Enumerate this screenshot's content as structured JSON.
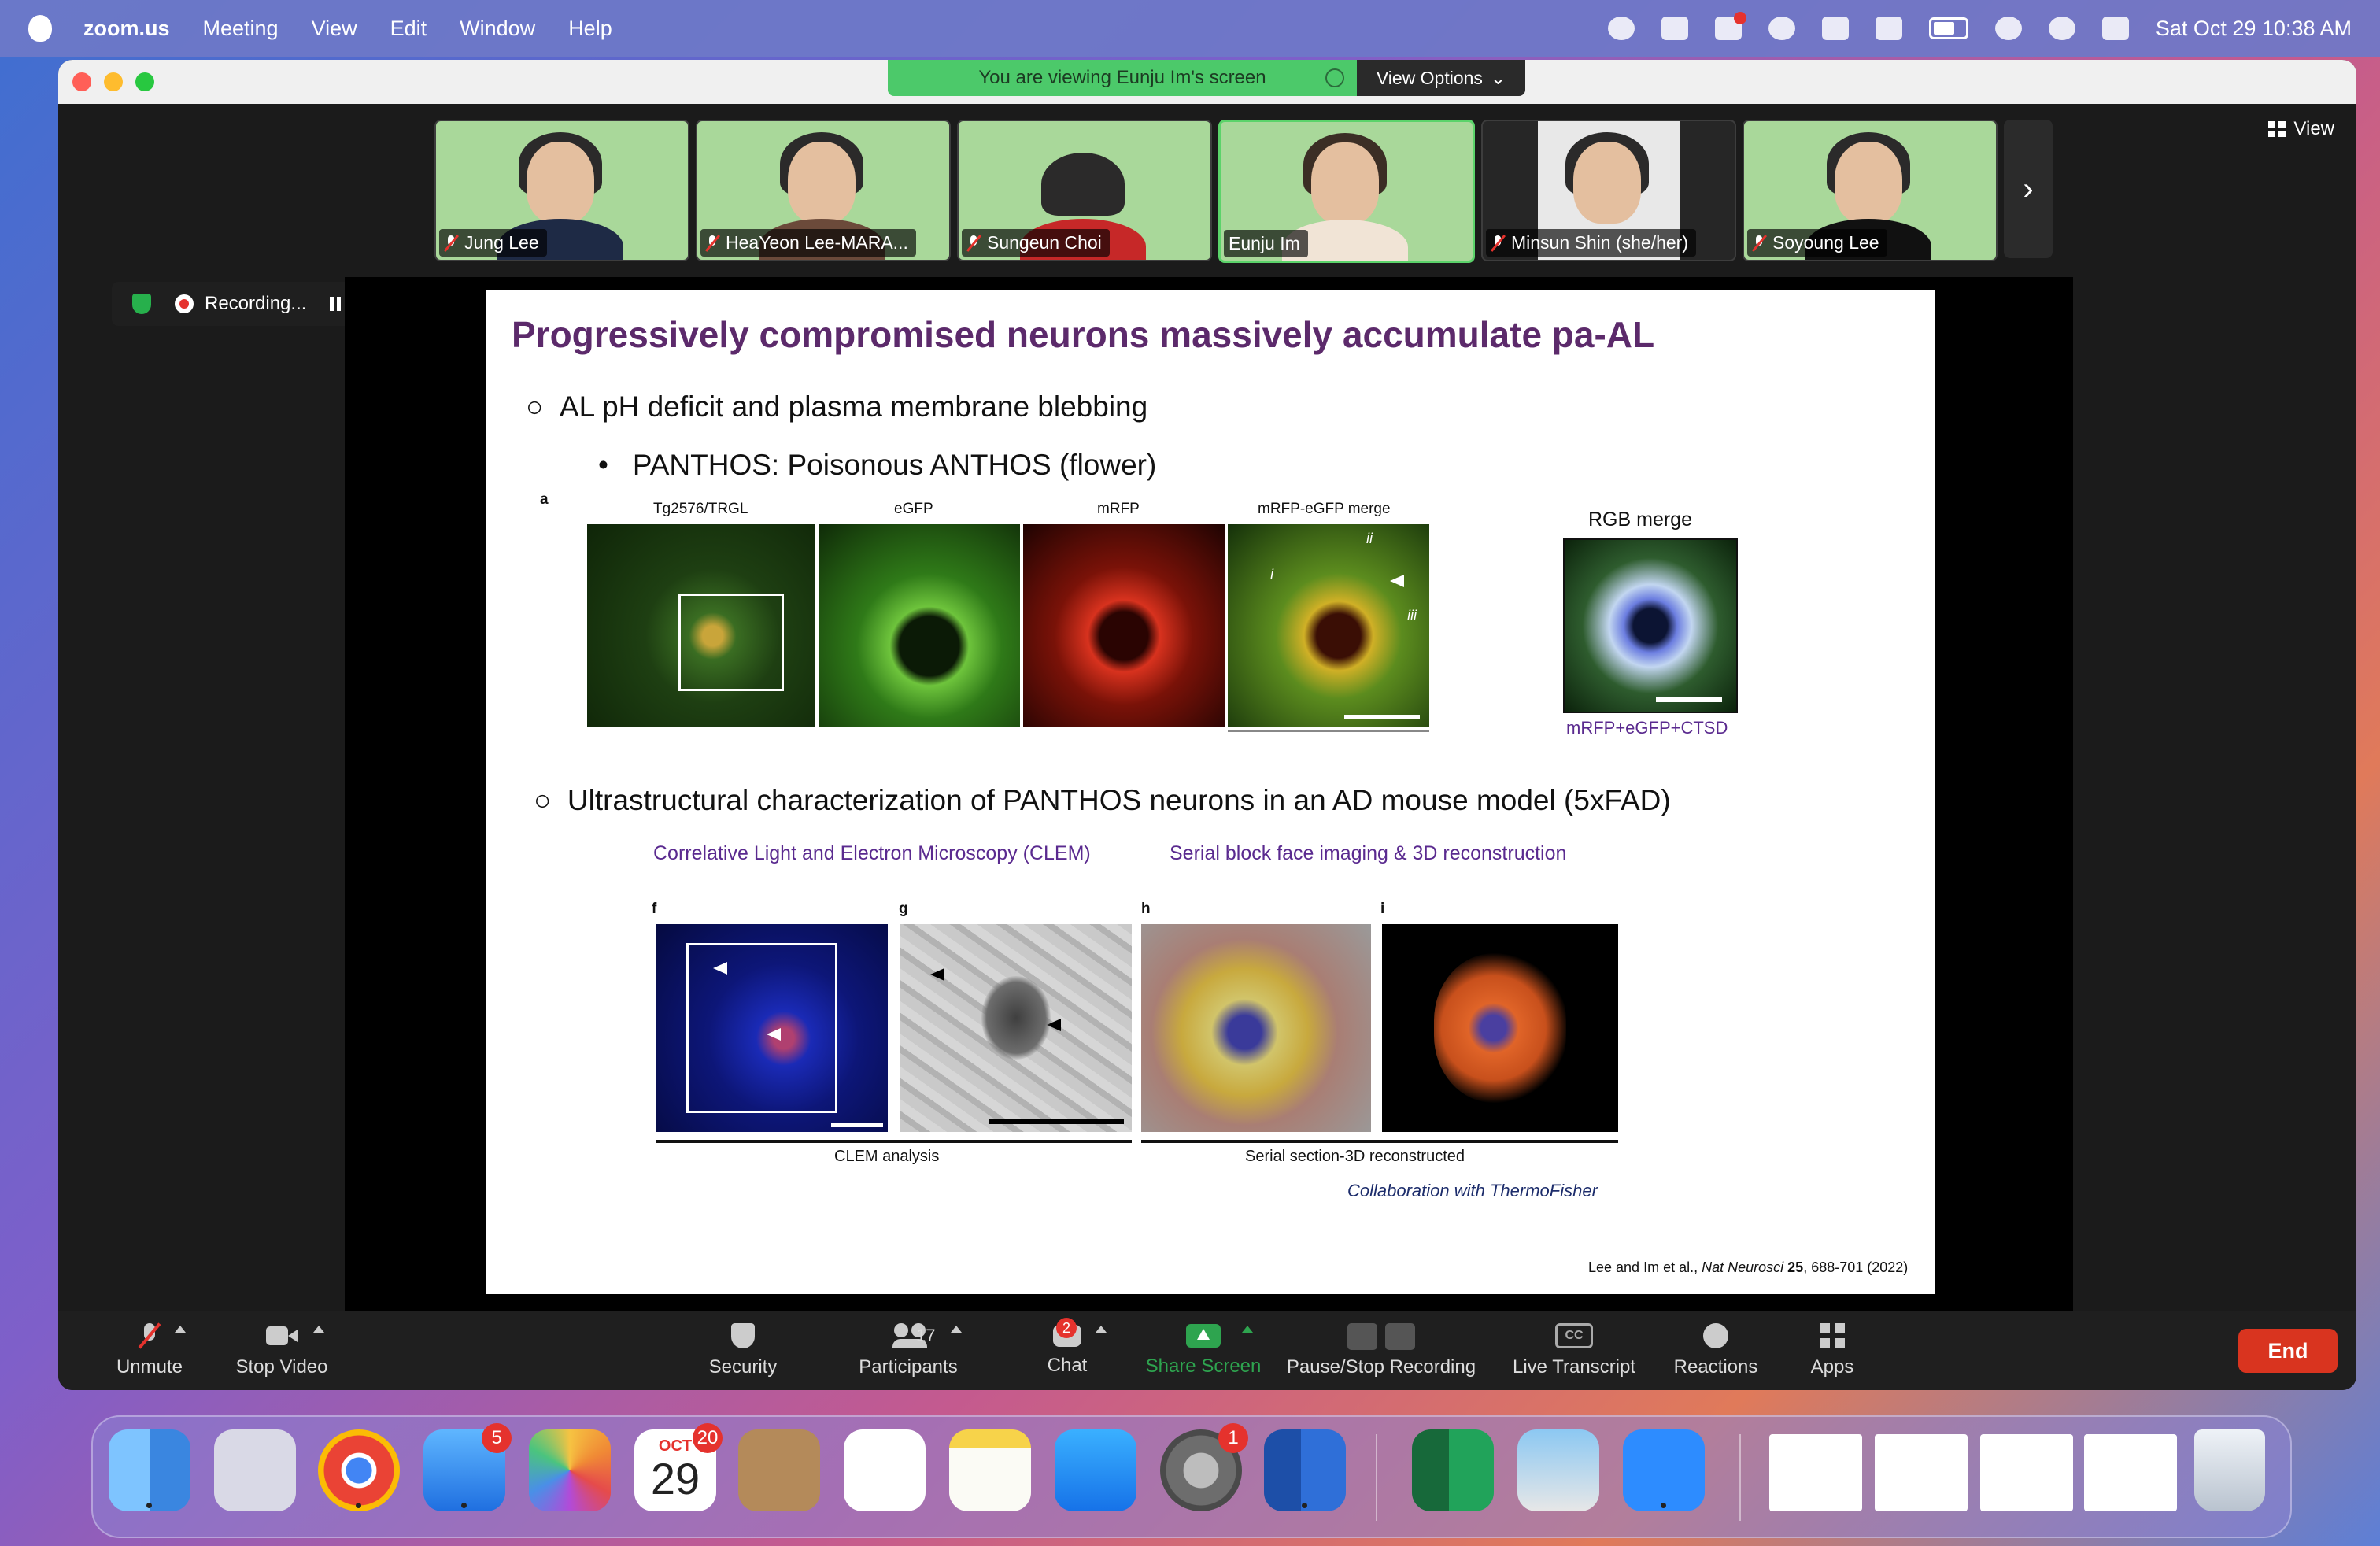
{
  "menubar": {
    "app_name": "zoom.us",
    "items": [
      "Meeting",
      "View",
      "Edit",
      "Window",
      "Help"
    ],
    "datetime": "Sat Oct 29  10:38 AM"
  },
  "window": {
    "share_banner": "You are viewing Eunju Im's screen",
    "view_options": "View Options",
    "view_label": "View"
  },
  "participants": [
    {
      "name": "Jung Lee",
      "muted": true
    },
    {
      "name": "HeaYeon Lee-MARA...",
      "muted": true
    },
    {
      "name": "Sungeun Choi",
      "muted": true
    },
    {
      "name": "Eunju Im",
      "muted": false,
      "active": true
    },
    {
      "name": "Minsun Shin (she/her)",
      "muted": true
    },
    {
      "name": "Soyoung Lee",
      "muted": true
    }
  ],
  "recording": {
    "label": "Recording..."
  },
  "slide": {
    "title": "Progressively compromised neurons massively accumulate pa-AL",
    "bullet1": "AL pH deficit and plasma membrane blebbing",
    "bullet2": "PANTHOS: Poisonous ANTHOS (flower)",
    "bullet_marker_circle": "○",
    "bullet_marker_dot": "•",
    "panel_a_letter": "a",
    "panel_a_labels": [
      "Tg2576/TRGL",
      "eGFP",
      "mRFP",
      "mRFP-eGFP merge"
    ],
    "merge_markers": [
      "ii",
      "i",
      "iii"
    ],
    "rgb_title": "RGB merge",
    "rgb_caption": "mRFP+eGFP+CTSD",
    "bullet3": "Ultrastructural characterization of PANTHOS neurons in an AD mouse model (5xFAD)",
    "sub_left": "Correlative Light and Electron Microscopy (CLEM)",
    "sub_right": "Serial block face imaging & 3D reconstruction",
    "panel_letters": [
      "f",
      "g",
      "h",
      "i"
    ],
    "caption_clem": "CLEM analysis",
    "caption_serial": "Serial section-3D reconstructed",
    "collaboration": "Collaboration with ThermoFisher",
    "citation_prefix": "Lee and Im et al.,",
    "citation_journal": "Nat Neurosci",
    "citation_volume": "25",
    "citation_pages": ", 688-701 (2022)"
  },
  "toolbar": {
    "unmute": "Unmute",
    "stop_video": "Stop Video",
    "security": "Security",
    "participants": "Participants",
    "participants_count": "17",
    "chat": "Chat",
    "chat_badge": "2",
    "share_screen": "Share Screen",
    "pause_stop_recording": "Pause/Stop Recording",
    "live_transcript": "Live Transcript",
    "cc": "CC",
    "reactions": "Reactions",
    "apps": "Apps",
    "end": "End"
  },
  "dock": {
    "mail_badge": "5",
    "calendar_month": "OCT",
    "calendar_day": "29",
    "calendar_badge": "20",
    "settings_badge": "1"
  },
  "colors": {
    "slide_title": "#5c2a6b",
    "subtitle_purple": "#5a2a8f",
    "share_green": "#2ea44f",
    "end_red": "#d9341f"
  }
}
